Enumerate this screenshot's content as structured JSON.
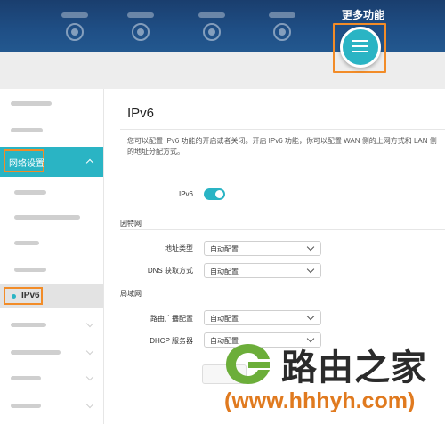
{
  "header": {
    "more_title": "更多功能",
    "more_icon": "hamburger-icon",
    "accent": "#2ab4c4",
    "highlight": "#f28c28"
  },
  "sidebar": {
    "network_settings": "网络设置",
    "ipv6": "IPv6"
  },
  "main": {
    "title": "IPv6",
    "description": "您可以配置 IPv6 功能的开启或者关闭。开启 IPv6 功能，你可以配置 WAN 侧的上网方式和 LAN 侧的地址分配方式。",
    "ipv6_toggle_label": "IPv6",
    "ipv6_enabled": true,
    "internet_section": "因特网",
    "address_type_label": "地址类型",
    "address_type_value": "自动配置",
    "dns_label": "DNS 获取方式",
    "dns_value": "自动配置",
    "lan_section": "局域网",
    "router_advert_label": "路由广播配置",
    "router_advert_value": "自动配置",
    "dhcp_label": "DHCP 服务器",
    "dhcp_value": "自动配置"
  },
  "watermark": {
    "site_name": "路由之家",
    "url": "(www.hhhyh.com)"
  }
}
